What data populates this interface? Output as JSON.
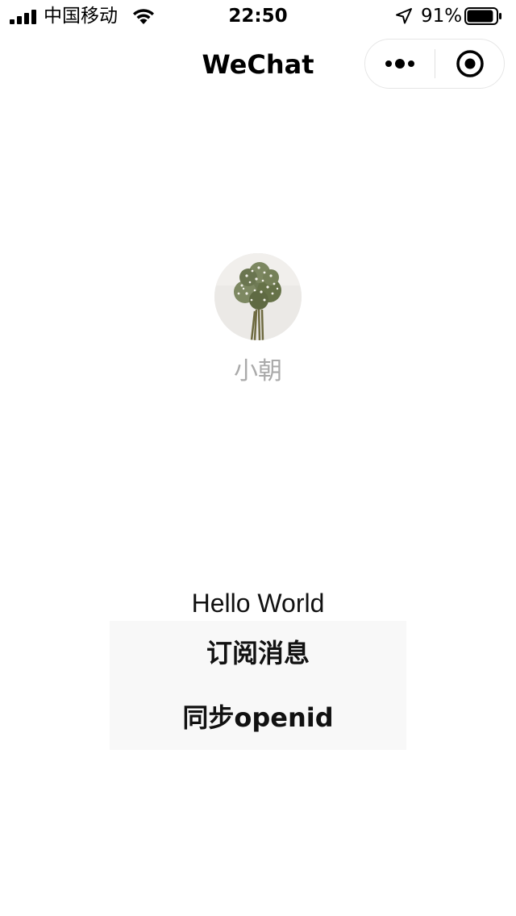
{
  "status_bar": {
    "carrier": "中国移动",
    "time": "22:50",
    "battery_percent": "91%",
    "battery_level": 0.91,
    "icons": [
      "signal-icon",
      "wifi-icon",
      "location-arrow-icon",
      "battery-icon"
    ]
  },
  "nav": {
    "title": "WeChat",
    "capsule_icons": [
      "more-icon",
      "close-miniprogram-icon"
    ]
  },
  "profile": {
    "nickname": "小朝"
  },
  "content": {
    "hello_text": "Hello World"
  },
  "buttons": {
    "subscribe_label": "订阅消息",
    "sync_openid_label": "同步openid"
  },
  "colors": {
    "button_bg": "#f8f8f8",
    "nickname_text": "#aaaaaa"
  }
}
